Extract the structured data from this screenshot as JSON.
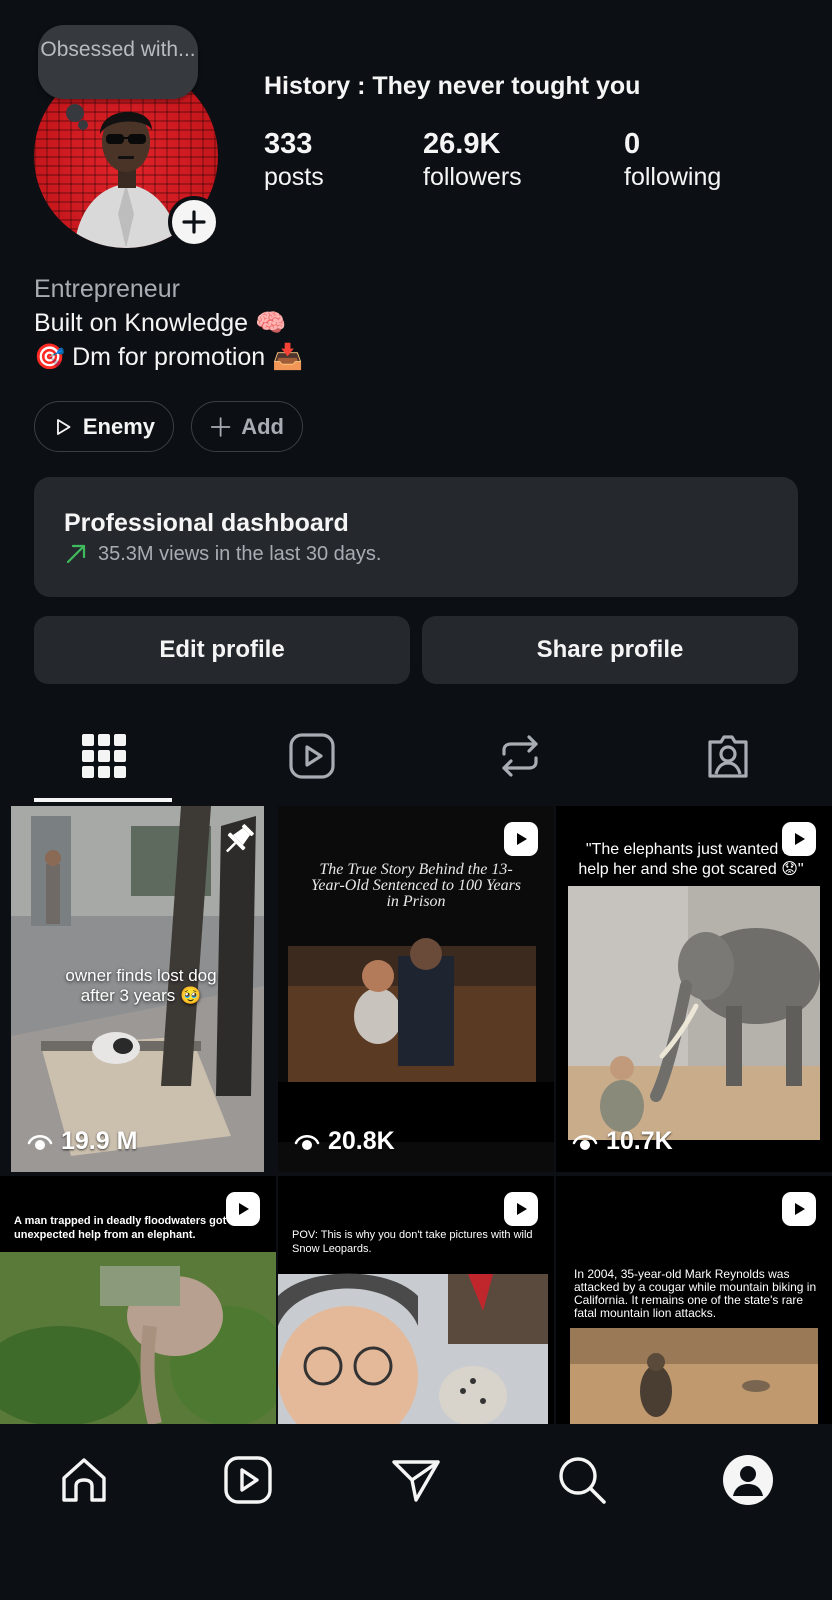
{
  "header": {
    "note": "Obsessed with...",
    "name": "History : They never tought you",
    "stats": [
      {
        "value": "333",
        "label": "posts"
      },
      {
        "value": "26.9K",
        "label": "followers"
      },
      {
        "value": "0",
        "label": "following"
      }
    ]
  },
  "bio": {
    "category": "Entrepreneur",
    "line1": "Built on Knowledge 🧠",
    "line2": "🎯 Dm for promotion 📥"
  },
  "highlights": [
    {
      "label": "Enemy"
    },
    {
      "label": "Add"
    }
  ],
  "dashboard": {
    "title": "Professional dashboard",
    "subtitle": "35.3M views in the last 30 days."
  },
  "actions": {
    "edit": "Edit profile",
    "share": "Share profile"
  },
  "tabs": {
    "icons": [
      "grid-icon",
      "reels-icon",
      "reposts-icon",
      "tagged-icon"
    ],
    "active": 0
  },
  "posts": [
    {
      "caption": "owner finds lost dog after 3 years 🥹",
      "views": "19.9 M",
      "pinned": true
    },
    {
      "caption": "The True Story Behind the 13-Year-Old Sentenced to 100 Years in Prison",
      "views": "20.8K",
      "reel": true
    },
    {
      "caption": "\"The elephants just wanted to help her and she got scared 😟\"",
      "views": "10.7K",
      "reel": true
    },
    {
      "caption": "A man trapped in deadly floodwaters got unexpected help from an elephant.",
      "reel": true
    },
    {
      "caption": "POV: This is why you don't take pictures with wild Snow Leopards.",
      "reel": true
    },
    {
      "caption": "In 2004, 35-year-old Mark Reynolds was attacked by a cougar while mountain biking in California. It remains one of the state's rare fatal mountain lion attacks.",
      "reel": true
    }
  ],
  "bottom_nav": [
    "home-icon",
    "reels-icon",
    "messages-icon",
    "search-icon",
    "profile-icon"
  ],
  "colors": {
    "background": "#0c1014",
    "card": "#25292e",
    "muted_text": "#a8adb3",
    "trend_green": "#3fba5c",
    "avatar_red": "#c4161c"
  }
}
